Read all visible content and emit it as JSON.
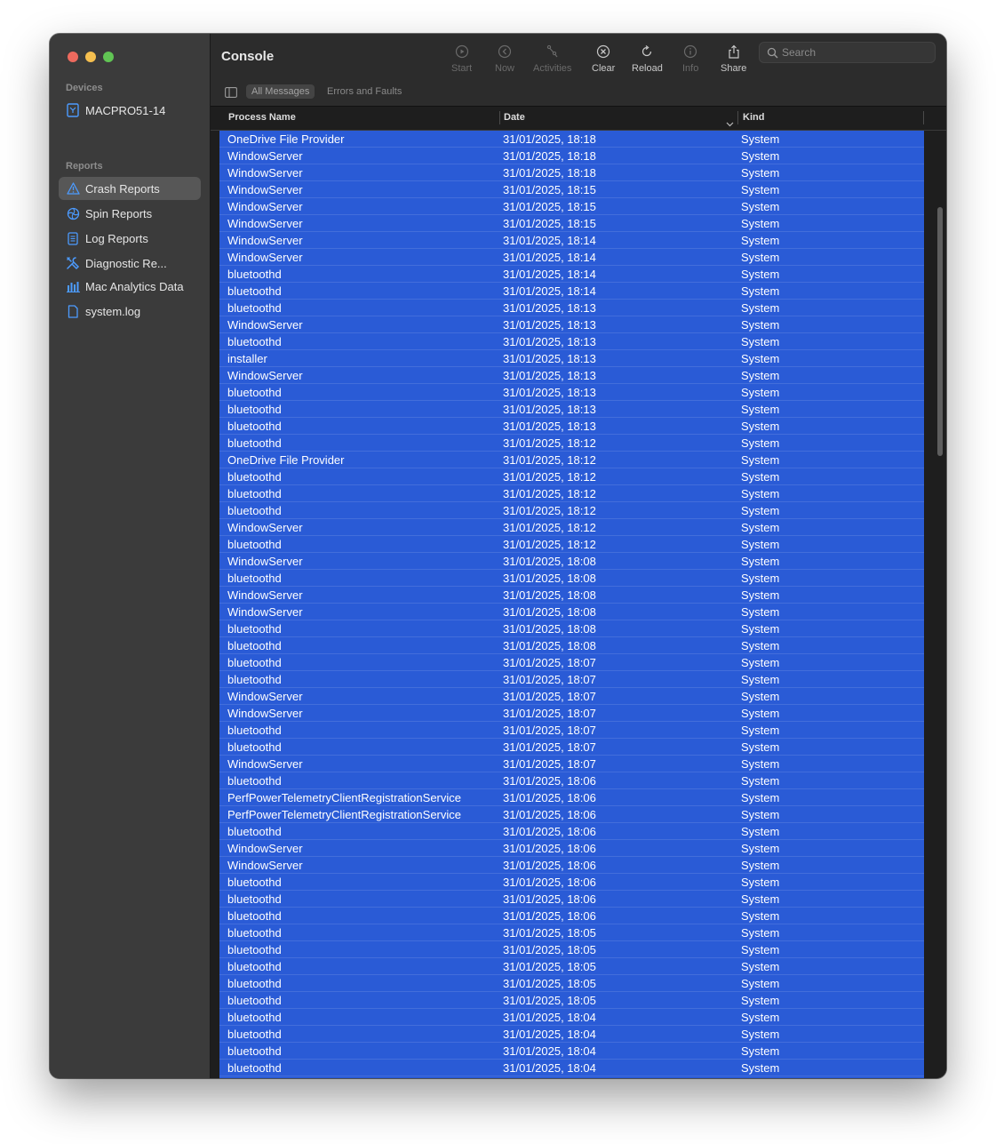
{
  "window": {
    "title": "Console"
  },
  "sidebar": {
    "devices_title": "Devices",
    "device": {
      "label": "MACPRO51-14",
      "icon": "device-icon"
    },
    "reports_title": "Reports",
    "items": [
      {
        "label": "Crash Reports",
        "icon": "warning-triangle-icon",
        "selected": true
      },
      {
        "label": "Spin Reports",
        "icon": "spin-icon",
        "selected": false
      },
      {
        "label": "Log Reports",
        "icon": "document-icon",
        "selected": false
      },
      {
        "label": "Diagnostic Re...",
        "icon": "tools-icon",
        "selected": false
      },
      {
        "label": "Mac Analytics Data",
        "icon": "bar-chart-icon",
        "selected": false
      },
      {
        "label": "system.log",
        "icon": "file-icon",
        "selected": false
      }
    ]
  },
  "toolbar": {
    "start": "Start",
    "now": "Now",
    "activities": "Activities",
    "clear": "Clear",
    "reload": "Reload",
    "info": "Info",
    "share": "Share",
    "search_placeholder": "Search"
  },
  "filters": {
    "all_messages": "All Messages",
    "errors_faults": "Errors and Faults"
  },
  "table": {
    "columns": {
      "process": "Process Name",
      "date": "Date",
      "kind": "Kind"
    },
    "rows": [
      [
        "OneDrive File Provider",
        "31/01/2025, 18:18",
        "System"
      ],
      [
        "WindowServer",
        "31/01/2025, 18:18",
        "System"
      ],
      [
        "WindowServer",
        "31/01/2025, 18:18",
        "System"
      ],
      [
        "WindowServer",
        "31/01/2025, 18:15",
        "System"
      ],
      [
        "WindowServer",
        "31/01/2025, 18:15",
        "System"
      ],
      [
        "WindowServer",
        "31/01/2025, 18:15",
        "System"
      ],
      [
        "WindowServer",
        "31/01/2025, 18:14",
        "System"
      ],
      [
        "WindowServer",
        "31/01/2025, 18:14",
        "System"
      ],
      [
        "bluetoothd",
        "31/01/2025, 18:14",
        "System"
      ],
      [
        "bluetoothd",
        "31/01/2025, 18:14",
        "System"
      ],
      [
        "bluetoothd",
        "31/01/2025, 18:13",
        "System"
      ],
      [
        "WindowServer",
        "31/01/2025, 18:13",
        "System"
      ],
      [
        "bluetoothd",
        "31/01/2025, 18:13",
        "System"
      ],
      [
        "installer",
        "31/01/2025, 18:13",
        "System"
      ],
      [
        "WindowServer",
        "31/01/2025, 18:13",
        "System"
      ],
      [
        "bluetoothd",
        "31/01/2025, 18:13",
        "System"
      ],
      [
        "bluetoothd",
        "31/01/2025, 18:13",
        "System"
      ],
      [
        "bluetoothd",
        "31/01/2025, 18:13",
        "System"
      ],
      [
        "bluetoothd",
        "31/01/2025, 18:12",
        "System"
      ],
      [
        "OneDrive File Provider",
        "31/01/2025, 18:12",
        "System"
      ],
      [
        "bluetoothd",
        "31/01/2025, 18:12",
        "System"
      ],
      [
        "bluetoothd",
        "31/01/2025, 18:12",
        "System"
      ],
      [
        "bluetoothd",
        "31/01/2025, 18:12",
        "System"
      ],
      [
        "WindowServer",
        "31/01/2025, 18:12",
        "System"
      ],
      [
        "bluetoothd",
        "31/01/2025, 18:12",
        "System"
      ],
      [
        "WindowServer",
        "31/01/2025, 18:08",
        "System"
      ],
      [
        "bluetoothd",
        "31/01/2025, 18:08",
        "System"
      ],
      [
        "WindowServer",
        "31/01/2025, 18:08",
        "System"
      ],
      [
        "WindowServer",
        "31/01/2025, 18:08",
        "System"
      ],
      [
        "bluetoothd",
        "31/01/2025, 18:08",
        "System"
      ],
      [
        "bluetoothd",
        "31/01/2025, 18:08",
        "System"
      ],
      [
        "bluetoothd",
        "31/01/2025, 18:07",
        "System"
      ],
      [
        "bluetoothd",
        "31/01/2025, 18:07",
        "System"
      ],
      [
        "WindowServer",
        "31/01/2025, 18:07",
        "System"
      ],
      [
        "WindowServer",
        "31/01/2025, 18:07",
        "System"
      ],
      [
        "bluetoothd",
        "31/01/2025, 18:07",
        "System"
      ],
      [
        "bluetoothd",
        "31/01/2025, 18:07",
        "System"
      ],
      [
        "WindowServer",
        "31/01/2025, 18:07",
        "System"
      ],
      [
        "bluetoothd",
        "31/01/2025, 18:06",
        "System"
      ],
      [
        "PerfPowerTelemetryClientRegistrationService",
        "31/01/2025, 18:06",
        "System"
      ],
      [
        "PerfPowerTelemetryClientRegistrationService",
        "31/01/2025, 18:06",
        "System"
      ],
      [
        "bluetoothd",
        "31/01/2025, 18:06",
        "System"
      ],
      [
        "WindowServer",
        "31/01/2025, 18:06",
        "System"
      ],
      [
        "WindowServer",
        "31/01/2025, 18:06",
        "System"
      ],
      [
        "bluetoothd",
        "31/01/2025, 18:06",
        "System"
      ],
      [
        "bluetoothd",
        "31/01/2025, 18:06",
        "System"
      ],
      [
        "bluetoothd",
        "31/01/2025, 18:06",
        "System"
      ],
      [
        "bluetoothd",
        "31/01/2025, 18:05",
        "System"
      ],
      [
        "bluetoothd",
        "31/01/2025, 18:05",
        "System"
      ],
      [
        "bluetoothd",
        "31/01/2025, 18:05",
        "System"
      ],
      [
        "bluetoothd",
        "31/01/2025, 18:05",
        "System"
      ],
      [
        "bluetoothd",
        "31/01/2025, 18:05",
        "System"
      ],
      [
        "bluetoothd",
        "31/01/2025, 18:04",
        "System"
      ],
      [
        "bluetoothd",
        "31/01/2025, 18:04",
        "System"
      ],
      [
        "bluetoothd",
        "31/01/2025, 18:04",
        "System"
      ],
      [
        "bluetoothd",
        "31/01/2025, 18:04",
        "System"
      ]
    ]
  },
  "colors": {
    "selection": "#2a5bd6",
    "sidebar_bg": "#3b3b3b",
    "accent_icon": "#4c9bff"
  }
}
